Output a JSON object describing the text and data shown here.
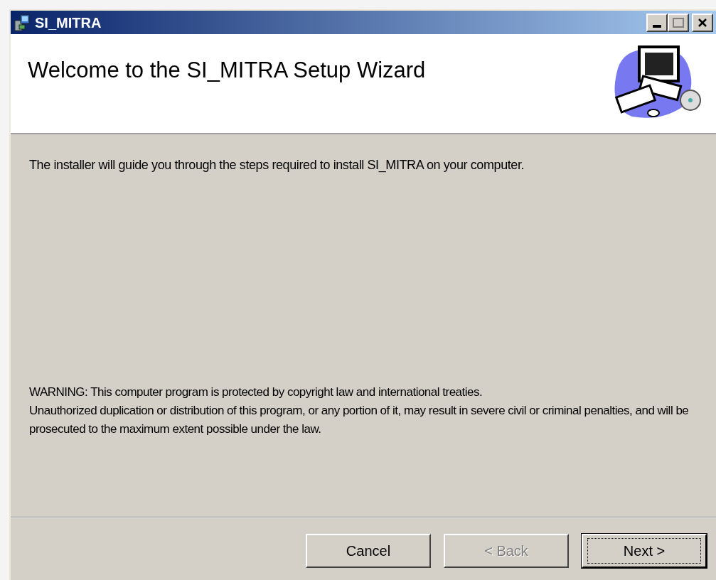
{
  "window": {
    "title": "SI_MITRA"
  },
  "header": {
    "title": "Welcome to the SI_MITRA Setup Wizard"
  },
  "intro": "The installer will guide you through the steps required to install SI_MITRA on your computer.",
  "warning": "WARNING: This computer program is protected by copyright law and international treaties.\nUnauthorized duplication or distribution of this program, or any portion of it, may result in severe civil or criminal penalties, and will be prosecuted to the maximum extent possible under the law.",
  "buttons": [
    {
      "label": "Cancel",
      "disabled": false,
      "default": false
    },
    {
      "label": "< Back",
      "disabled": true,
      "default": false
    },
    {
      "label": "Next >",
      "disabled": false,
      "default": true
    }
  ]
}
